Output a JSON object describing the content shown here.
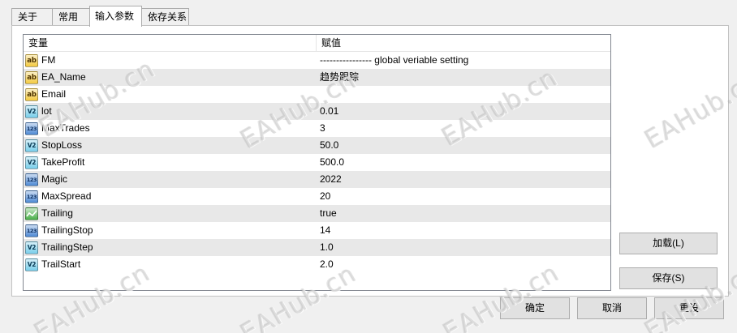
{
  "tabs": [
    {
      "label": "关于",
      "selected": false
    },
    {
      "label": "常用",
      "selected": false
    },
    {
      "label": "输入参数",
      "selected": true
    },
    {
      "label": "依存关系",
      "selected": false
    }
  ],
  "table": {
    "headers": {
      "variable": "变量",
      "value": "赋值"
    },
    "rows": [
      {
        "name": "FM",
        "value": "---------------- global veriable setting",
        "icon": "string-type-icon"
      },
      {
        "name": "EA_Name",
        "value": "趋势跟踪",
        "icon": "string-type-icon"
      },
      {
        "name": "Email",
        "value": "",
        "icon": "string-type-icon"
      },
      {
        "name": "lot",
        "value": "0.01",
        "icon": "double-type-icon"
      },
      {
        "name": "MaxTrades",
        "value": "3",
        "icon": "int-type-icon"
      },
      {
        "name": "StopLoss",
        "value": "50.0",
        "icon": "double-type-icon"
      },
      {
        "name": "TakeProfit",
        "value": "500.0",
        "icon": "double-type-icon"
      },
      {
        "name": "Magic",
        "value": "2022",
        "icon": "int-type-icon"
      },
      {
        "name": "MaxSpread",
        "value": "20",
        "icon": "int-type-icon"
      },
      {
        "name": "Trailing",
        "value": "true",
        "icon": "bool-type-icon"
      },
      {
        "name": "TrailingStop",
        "value": "14",
        "icon": "int-type-icon"
      },
      {
        "name": "TrailingStep",
        "value": "1.0",
        "icon": "double-type-icon"
      },
      {
        "name": "TrailStart",
        "value": "2.0",
        "icon": "double-type-icon"
      }
    ]
  },
  "icon_types": {
    "string-type-icon": {
      "glyph": "ab",
      "color": "#f2c530"
    },
    "int-type-icon": {
      "glyph": "123",
      "color": "#3f7fd0"
    },
    "double-type-icon": {
      "glyph": "V2",
      "color": "#6cc9e8"
    },
    "bool-type-icon": {
      "color": "#3aa83a"
    }
  },
  "side_buttons": {
    "load_label": "加载(L)",
    "save_label": "保存(S)"
  },
  "footer_buttons": {
    "ok_label": "确定",
    "cancel_label": "取消",
    "reset_label": "重设"
  },
  "watermark": {
    "text": "EAHub.cn"
  }
}
